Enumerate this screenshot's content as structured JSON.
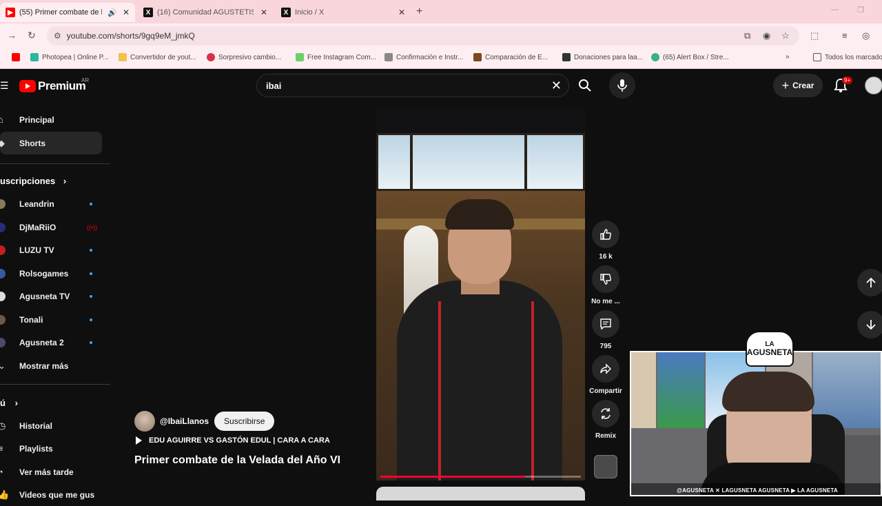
{
  "browser": {
    "tabs": [
      {
        "title": "(55) Primer combate de la V",
        "active": true
      },
      {
        "title": "(16) Comunidad AGUSTETISMO",
        "active": false
      },
      {
        "title": "Inicio / X",
        "active": false
      }
    ],
    "url": "youtube.com/shorts/9gq9eM_jmkQ",
    "bookmarks": [
      "Photopea | Online P...",
      "Convertidor de yout...",
      "Sorpresivo cambio...",
      "Free Instagram Com...",
      "Confirmación e Instr...",
      "Comparación de E...",
      "Donaciones para laa...",
      "(65) Alert Box / Stre..."
    ],
    "all_bookmarks": "Todos los marcado"
  },
  "header": {
    "brand": "Premium",
    "region": "AR",
    "search_query": "ibai",
    "create_label": "Crear",
    "notifications_badge": "9+"
  },
  "sidebar": {
    "main": [
      {
        "label": "Principal",
        "active": false
      },
      {
        "label": "Shorts",
        "active": true
      }
    ],
    "subs_heading": "uscripciones",
    "subscriptions": [
      {
        "label": "Leandrin",
        "status": "new"
      },
      {
        "label": "DjMaRiiO",
        "status": "live"
      },
      {
        "label": "LUZU TV",
        "status": "new"
      },
      {
        "label": "Rolsogames",
        "status": "new"
      },
      {
        "label": "Agusneta TV",
        "status": "new"
      },
      {
        "label": "Tonali",
        "status": "new"
      },
      {
        "label": "Agusneta 2",
        "status": "new"
      }
    ],
    "show_more": "Mostrar más",
    "you_heading": "ú",
    "you_items": [
      "Historial",
      "Playlists",
      "Ver más tarde",
      "Videos que me gus"
    ]
  },
  "short": {
    "channel": "@IbaiLlanos",
    "subscribe_label": "Suscribirse",
    "music": "EDU AGUIRRE VS GASTÓN EDUL | CARA A CARA",
    "title": "Primer combate de la Velada del Año VI",
    "progress": 0.72,
    "actions": {
      "likes": "16 k",
      "dislike": "No me ...",
      "comments": "795",
      "share": "Compartir",
      "remix": "Remix"
    }
  },
  "overlay": {
    "logo_top": "LA",
    "logo_bottom": "AGUSNETA",
    "footer": "@AGUSNETA   ✕ LAGUSNETA   AGUSNETA   ▶ LA AGUSNETA"
  },
  "colors": {
    "accent": "#ff0000",
    "background": "#0f0f0f",
    "link": "#3ea6ff"
  }
}
